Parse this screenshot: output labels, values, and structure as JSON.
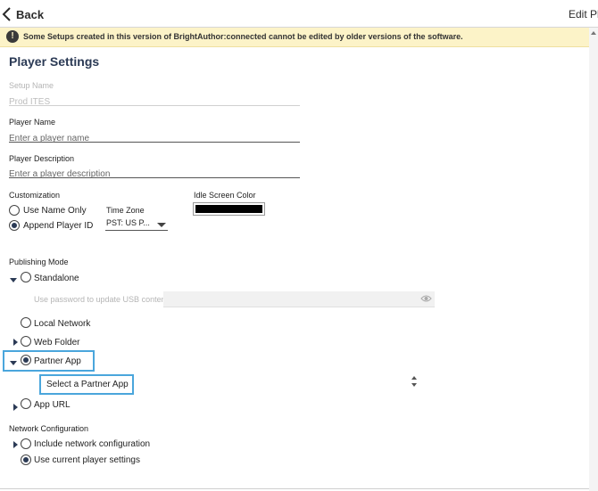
{
  "header": {
    "back_label": "Back",
    "title": "Edit Pla"
  },
  "warning": {
    "icon": "exclamation-icon",
    "text": "Some Setups created in this version of BrightAuthor:connected cannot be edited by older versions of the software."
  },
  "page": {
    "title": "Player Settings"
  },
  "setup_name": {
    "label": "Setup Name",
    "value": "Prod ITES"
  },
  "player_name": {
    "label": "Player Name",
    "placeholder": "Enter a player name"
  },
  "player_description": {
    "label": "Player Description",
    "placeholder": "Enter a player description"
  },
  "customization": {
    "label": "Customization",
    "options": [
      {
        "label": "Use Name Only",
        "selected": false
      },
      {
        "label": "Append Player ID",
        "selected": true
      }
    ]
  },
  "time_zone": {
    "label": "Time Zone",
    "value": "PST: US P..."
  },
  "idle_screen": {
    "label": "Idle Screen Color",
    "color": "#000000"
  },
  "publishing": {
    "label": "Publishing Mode",
    "standalone_label": "Standalone",
    "password_placeholder": "Use password to update USB content",
    "local_network_label": "Local Network",
    "web_folder_label": "Web Folder",
    "partner_app_label": "Partner App",
    "partner_app_select_placeholder": "Select a Partner App",
    "app_url_label": "App URL",
    "selected": "Partner App"
  },
  "network": {
    "label": "Network Configuration",
    "options": [
      {
        "label": "Include network configuration",
        "selected": false
      },
      {
        "label": "Use current player settings",
        "selected": true
      }
    ]
  },
  "colors": {
    "accent": "#2b3a55",
    "highlight": "#4aa6dc",
    "warning_bg": "#fcf3c8"
  }
}
